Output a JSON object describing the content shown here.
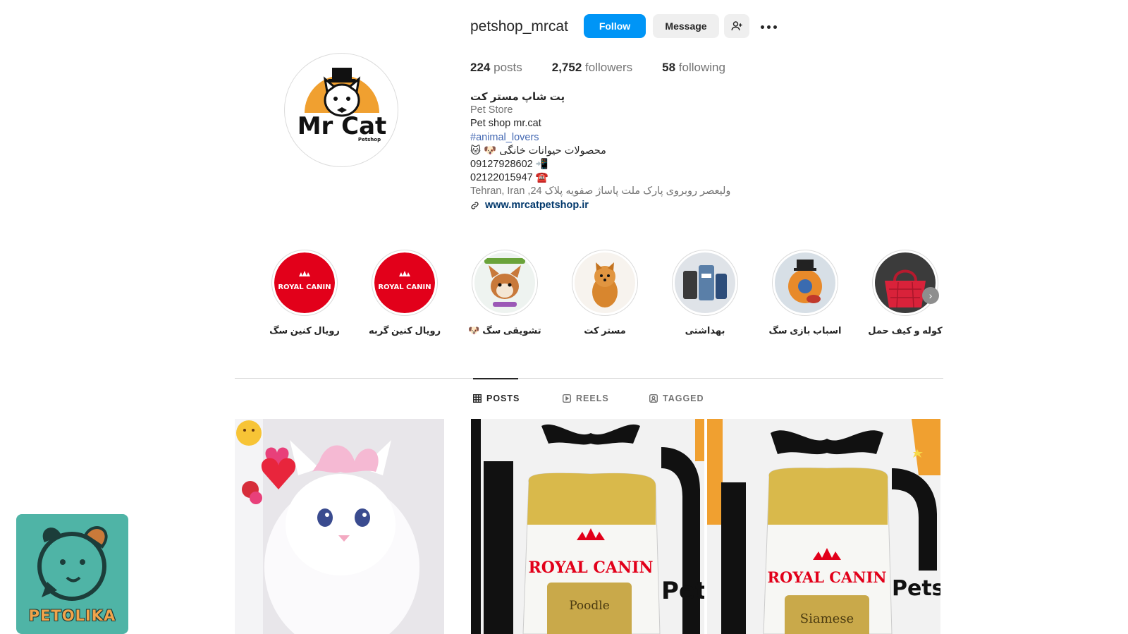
{
  "profile": {
    "username": "petshop_mrcat",
    "follow_label": "Follow",
    "message_label": "Message",
    "stats": {
      "posts_count": "224",
      "posts_label": "posts",
      "followers_count": "2,752",
      "followers_label": "followers",
      "following_count": "58",
      "following_label": "following"
    },
    "avatar_logo_text": "Mr Cat",
    "avatar_logo_sub": "Petshop",
    "bio": {
      "name": "پت شاپ مستر کت",
      "category": "Pet Store",
      "line1": "Pet shop mr.cat",
      "hashtag": "#animal_lovers",
      "line2": "محصولات حیوانات خانگی 🐶 🐱",
      "phone1": "09127928602 📲",
      "phone2": "02122015947 ☎️",
      "address": "ولیعصر روبروی پارک ملت پاساژ صفویه پلاک 24, Tehran, Iran",
      "website": "www.mrcatpetshop.ir"
    }
  },
  "highlights": [
    {
      "label": "رویال کنین سگ",
      "icon": "royal-canin-logo"
    },
    {
      "label": "رویال کنین گربه",
      "icon": "royal-canin-logo"
    },
    {
      "label": "تشویقی سگ 🐶",
      "icon": "dog-treat-package"
    },
    {
      "label": "مستر کت",
      "icon": "pomeranian-dog"
    },
    {
      "label": "بهداشتی",
      "icon": "hygiene-products"
    },
    {
      "label": "اسباب بازی سگ",
      "icon": "dog-toys"
    },
    {
      "label": "کوله و کیف حمل",
      "icon": "pet-carrier-bag"
    }
  ],
  "tabs": [
    {
      "label": "POSTS",
      "icon": "grid-icon",
      "active": true
    },
    {
      "label": "REELS",
      "icon": "reels-icon",
      "active": false
    },
    {
      "label": "TAGGED",
      "icon": "tagged-icon",
      "active": false
    }
  ],
  "posts": [
    {
      "subject": "white-persian-cat-with-pink-bow"
    },
    {
      "subject": "royal-canin-poodle-bag",
      "brand_text": "ROYAL CANIN",
      "product_text": "Poodle",
      "bg_text": "Pet"
    },
    {
      "subject": "royal-canin-siamese-bag",
      "brand_text": "ROYAL CANIN",
      "product_text": "Siamese",
      "bg_text": "Pets"
    }
  ],
  "watermark": {
    "text": "PETOLIKA"
  },
  "colors": {
    "follow_blue": "#0095f6",
    "link_blue": "#00376b",
    "hashtag_blue": "#4267b2",
    "royal_canin_red": "#e2001a"
  }
}
